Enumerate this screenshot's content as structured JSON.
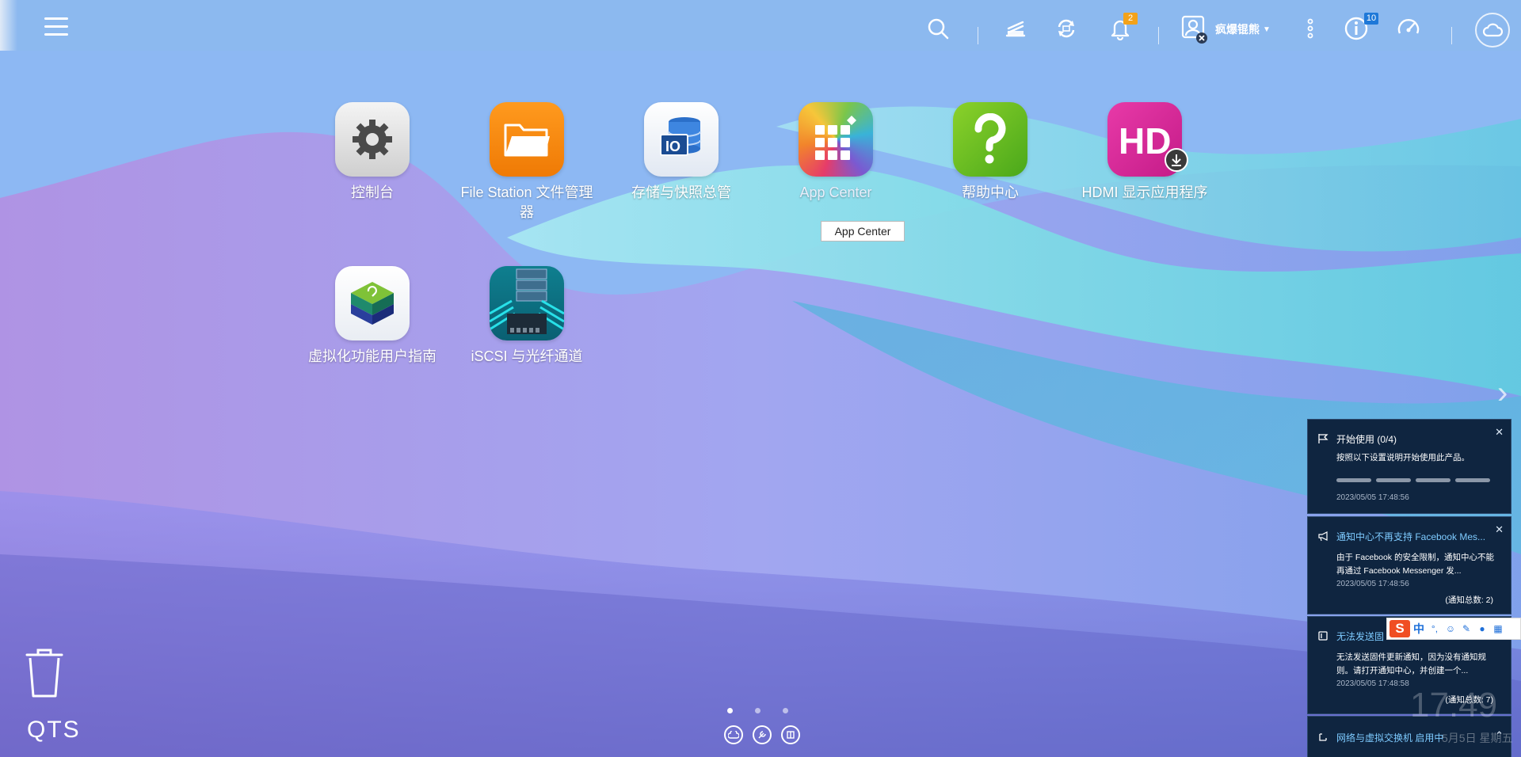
{
  "topbar": {
    "notification_badge": "2",
    "info_badge": "10",
    "username": "疯爆锟熊",
    "icons": [
      "menu-icon",
      "search-icon",
      "task-icon",
      "sync-icon",
      "bell-icon",
      "user-icon",
      "more-icon",
      "info-icon",
      "dashboard-icon",
      "cloud-icon"
    ]
  },
  "apps": [
    {
      "label": "控制台",
      "icon": "gear-icon"
    },
    {
      "label": "File Station 文件管理器",
      "icon": "folder-icon"
    },
    {
      "label": "存储与快照总管",
      "icon": "storage-icon"
    },
    {
      "label": "App Center",
      "icon": "app-grid-icon"
    },
    {
      "label": "帮助中心",
      "icon": "help-icon"
    },
    {
      "label": "HDMI 显示应用程序",
      "icon": "hdmi-icon"
    },
    {
      "label": "虚拟化功能用户指南",
      "icon": "virtualization-icon"
    },
    {
      "label": "iSCSI 与光纤通道",
      "icon": "iscsi-icon"
    }
  ],
  "tooltip": "App Center",
  "logo": "QTS",
  "notifications": [
    {
      "title": "开始使用 (0/4)",
      "body": "按照以下设置说明开始使用此产品。",
      "time": "2023/05/05 17:48:56"
    },
    {
      "title": "通知中心不再支持 Facebook Mes...",
      "body": "由于 Facebook 的安全限制，通知中心不能再通过 Facebook Messenger 发...",
      "time": "2023/05/05 17:48:56",
      "count": "(通知总数: 2)"
    },
    {
      "title": "无法发送固",
      "body": "无法发送固件更新通知，因为没有通知规则。请打开通知中心，并创建一个...",
      "time": "2023/05/05 17:48:58",
      "count": "(通知总数: 7)"
    },
    {
      "title": "网络与虚拟交换机 启用中"
    }
  ],
  "ime": {
    "logo": "S",
    "mode": "中"
  },
  "clock": "17:49",
  "clock_sub": "5月5日 星期五"
}
